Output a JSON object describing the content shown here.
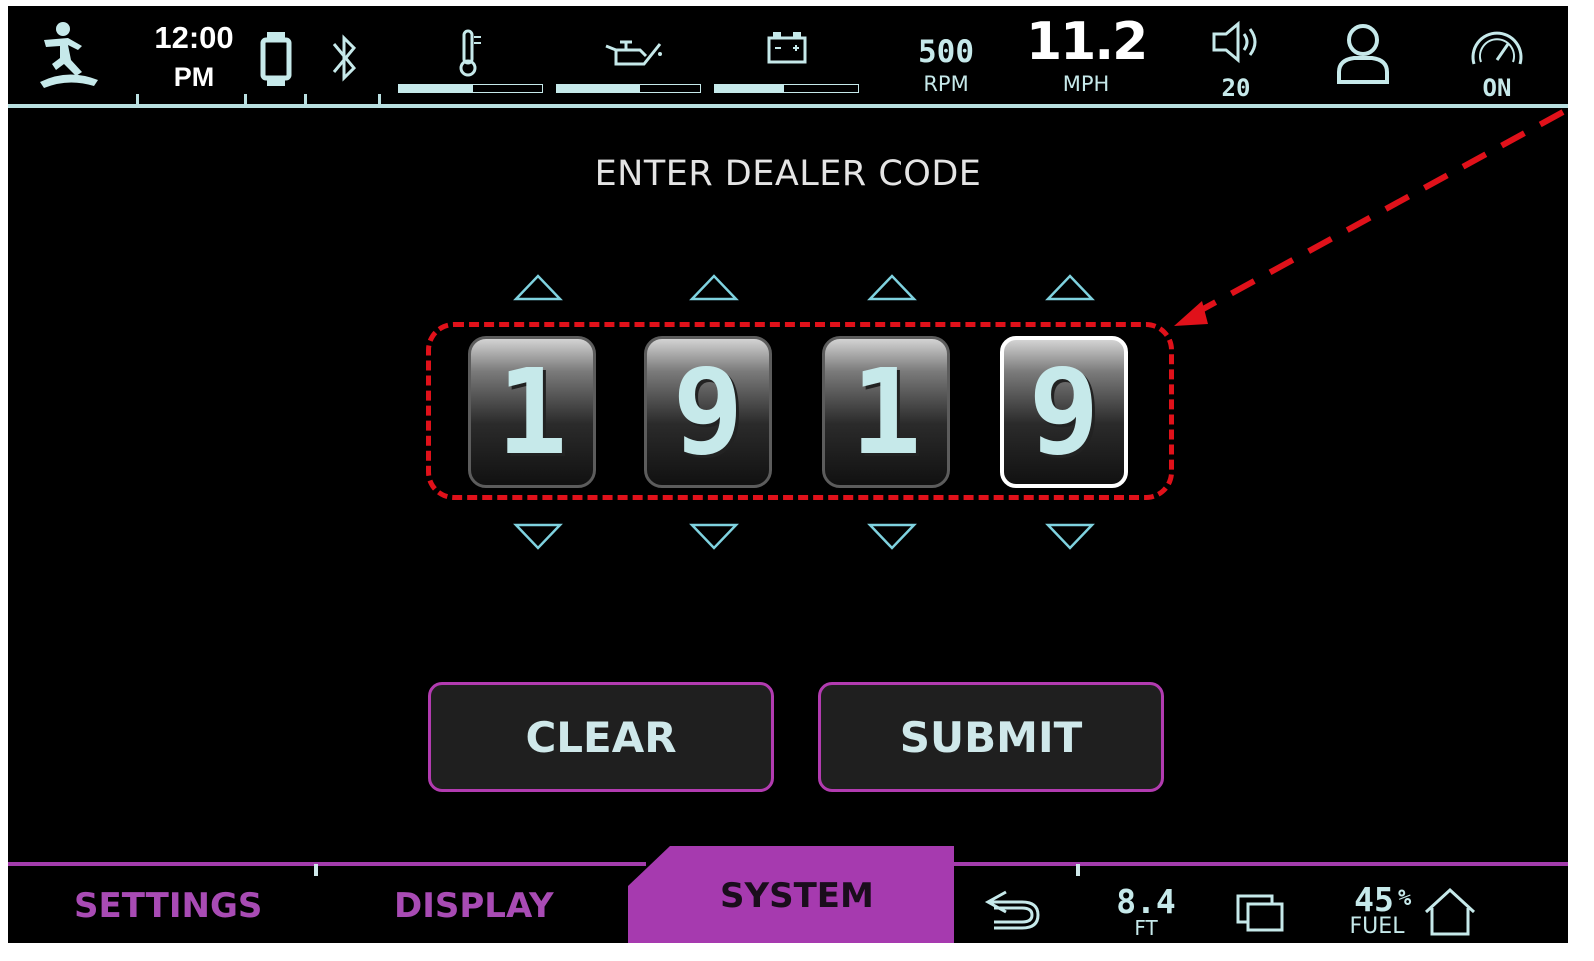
{
  "status_bar": {
    "time": "12:00",
    "ampm": "PM",
    "rpm_value": "500",
    "rpm_label": "RPM",
    "speed_value": "11.2",
    "speed_label": "MPH",
    "volume_value": "20",
    "cruise_state": "ON",
    "temp_level": 0.52,
    "oil_level": 0.58,
    "battery_level": 0.48
  },
  "title": "ENTER DEALER CODE",
  "digits": [
    "1",
    "9",
    "1",
    "9"
  ],
  "selected_digit_index": 3,
  "buttons": {
    "clear": "CLEAR",
    "submit": "SUBMIT"
  },
  "nav": {
    "tabs": [
      "SETTINGS",
      "DISPLAY",
      "SYSTEM"
    ],
    "active_tab": "SYSTEM",
    "depth_value": "8.4",
    "depth_unit": "FT",
    "fuel_value": "45",
    "fuel_percent": "%",
    "fuel_label": "FUEL"
  },
  "colors": {
    "accent_cyan": "#c6e9ea",
    "accent_magenta": "#a33cac",
    "annotation_red": "#e0111a"
  },
  "icons": [
    "surfer-icon",
    "phone-icon",
    "bluetooth-icon",
    "thermometer-icon",
    "oil-can-icon",
    "battery-icon",
    "speaker-icon",
    "user-profile-icon",
    "cruise-gauge-icon",
    "back-arrow-icon",
    "screens-icon",
    "home-icon"
  ]
}
